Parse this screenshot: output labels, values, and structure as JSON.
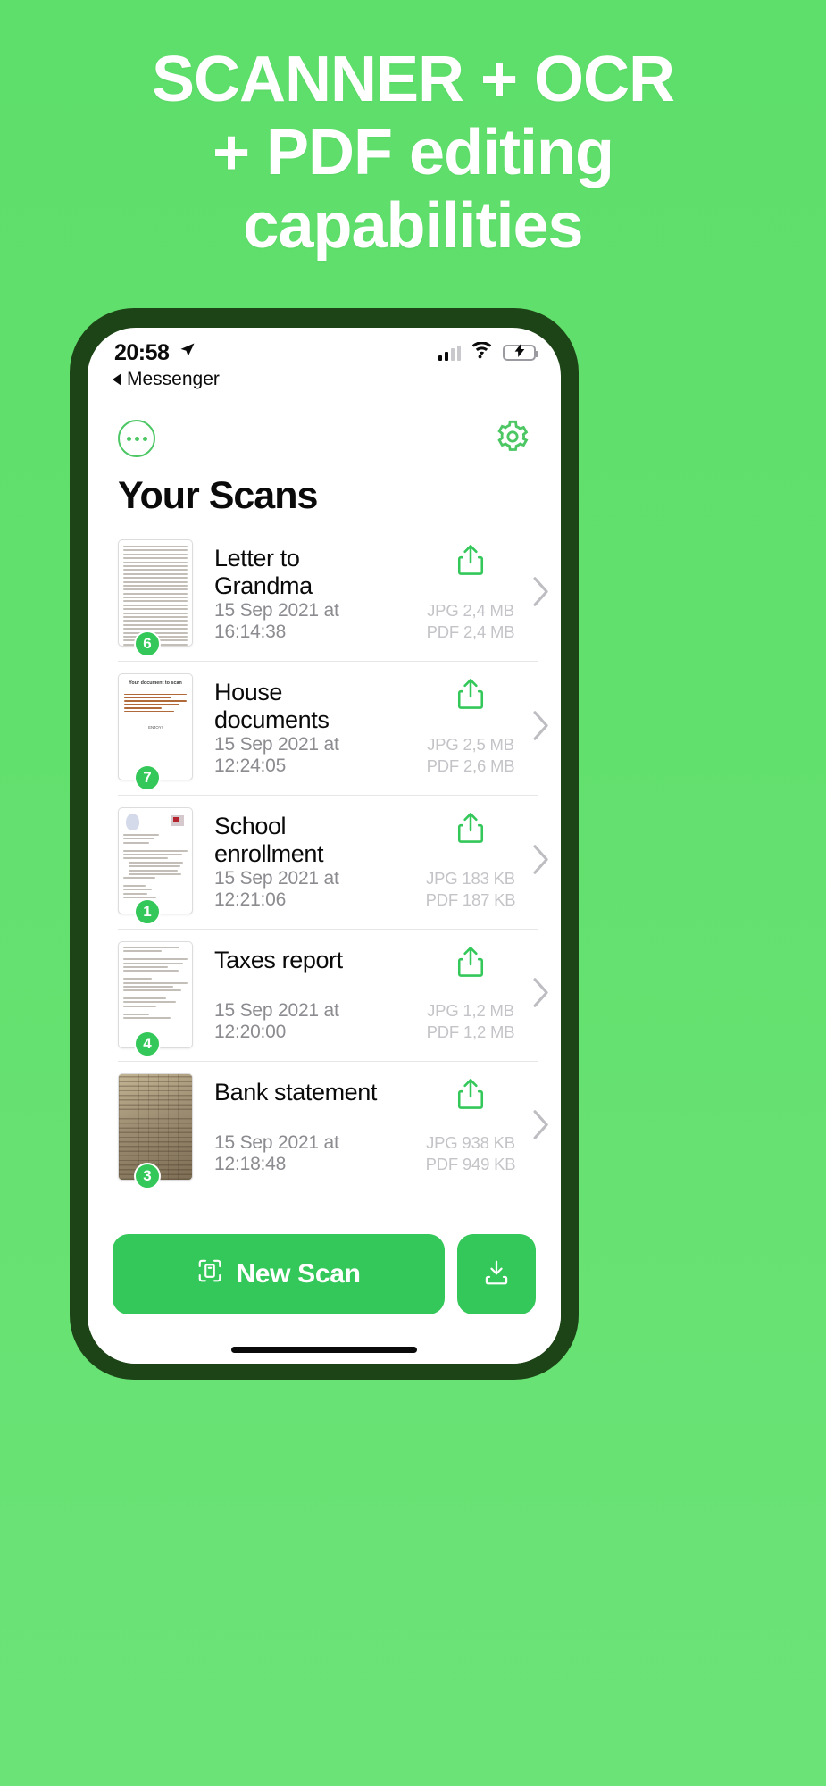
{
  "promo": {
    "line1": "SCANNER + OCR",
    "line2": "+ PDF editing",
    "line3": "capabilities",
    "background_color": "#62e06e",
    "text_color": "#ffffff"
  },
  "phone": {
    "frame_color": "#1d4416",
    "status_bar": {
      "time": "20:58",
      "location_icon": "location-arrow-icon",
      "back_label": "Messenger",
      "signal_icon": "cellular-signal-icon",
      "signal_bars_filled": 2,
      "signal_bars_total": 4,
      "wifi_icon": "wifi-icon",
      "battery_icon": "battery-charging-icon",
      "battery_color": "#34C759"
    }
  },
  "toolbar": {
    "more_icon": "more-options-icon",
    "settings_icon": "gear-icon",
    "accent_color": "#4cc764"
  },
  "main": {
    "page_title": "Your Scans",
    "share_icon": "share-icon",
    "chevron_icon": "chevron-right-icon",
    "scans": [
      {
        "title": "Letter to Grandma",
        "date": "15 Sep 2021 at 16:14:38",
        "jpg_size": "JPG 2,4 MB",
        "pdf_size": "PDF 2,4 MB",
        "page_count": "6",
        "thumb_type": "text"
      },
      {
        "title": "House documents",
        "date": "15 Sep 2021 at 12:24:05",
        "jpg_size": "JPG 2,5 MB",
        "pdf_size": "PDF 2,6 MB",
        "page_count": "7",
        "thumb_type": "doc",
        "thumb_heading": "Your document to scan",
        "thumb_footer": "ENJOY!"
      },
      {
        "title": "School enrollment",
        "date": "15 Sep 2021 at 12:21:06",
        "jpg_size": "JPG 183 KB",
        "pdf_size": "PDF 187 KB",
        "page_count": "1",
        "thumb_type": "school"
      },
      {
        "title": "Taxes report",
        "date": "15 Sep 2021 at 12:20:00",
        "jpg_size": "JPG 1,2 MB",
        "pdf_size": "PDF 1,2 MB",
        "page_count": "4",
        "thumb_type": "text"
      },
      {
        "title": "Bank statement",
        "date": "15 Sep 2021 at 12:18:48",
        "jpg_size": "JPG 938 KB",
        "pdf_size": "PDF 949 KB",
        "page_count": "3",
        "thumb_type": "bank"
      }
    ]
  },
  "bottom_bar": {
    "new_scan_label": "New Scan",
    "new_scan_icon": "scan-frame-icon",
    "import_icon": "download-icon",
    "button_color": "#34C759"
  }
}
